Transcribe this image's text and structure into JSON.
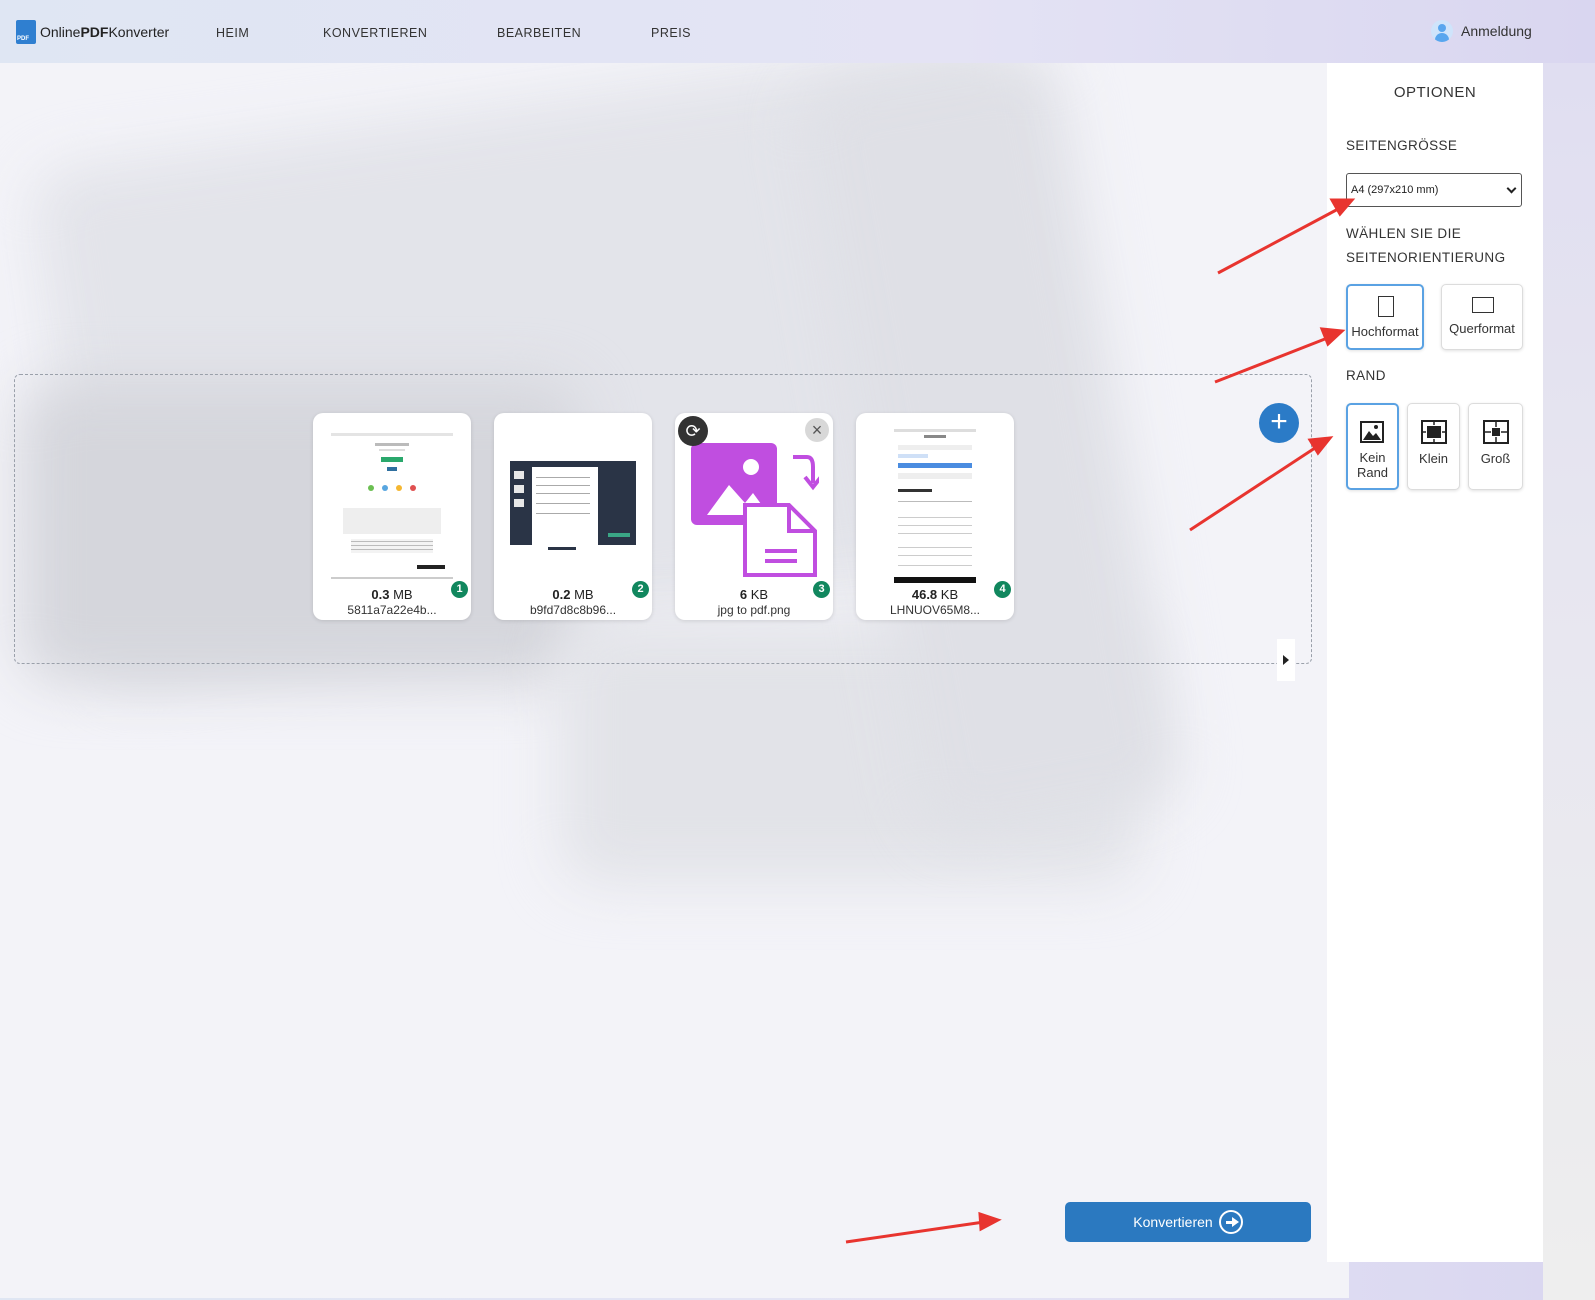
{
  "header": {
    "logo_plain": "Online",
    "logo_bold": "PDF",
    "logo_tail": "Konverter",
    "nav": [
      "HEIM",
      "KONVERTIEREN",
      "BEARBEITEN",
      "PREIS"
    ],
    "login": "Anmeldung"
  },
  "files": [
    {
      "size_value": "0.3",
      "size_unit": "MB",
      "name": "5811a7a22e4b...",
      "index": "1"
    },
    {
      "size_value": "0.2",
      "size_unit": "MB",
      "name": "b9fd7d8c8b96...",
      "index": "2"
    },
    {
      "size_value": "6",
      "size_unit": "KB",
      "name": "jpg to pdf.png",
      "index": "3"
    },
    {
      "size_value": "46.8",
      "size_unit": "KB",
      "name": "LHNUOV65M8...",
      "index": "4"
    }
  ],
  "main": {
    "convert_label": "Konvertieren"
  },
  "options": {
    "title": "OPTIONEN",
    "page_size_label": "SEITENGRÖSSE",
    "page_size_value": "A4 (297x210 mm)",
    "orientation_label_1": "WÄHLEN SIE DIE",
    "orientation_label_2": "SEITENORIENTIERUNG",
    "portrait": "Hochformat",
    "landscape": "Querformat",
    "margin_label": "RAND",
    "margin_none_1": "Kein",
    "margin_none_2": "Rand",
    "margin_small": "Klein",
    "margin_large": "Groß"
  },
  "colors": {
    "accent": "#2b79c0",
    "badge": "#11875e",
    "annotation_arrow": "#e8342f",
    "image_icon": "#c04ee0"
  }
}
